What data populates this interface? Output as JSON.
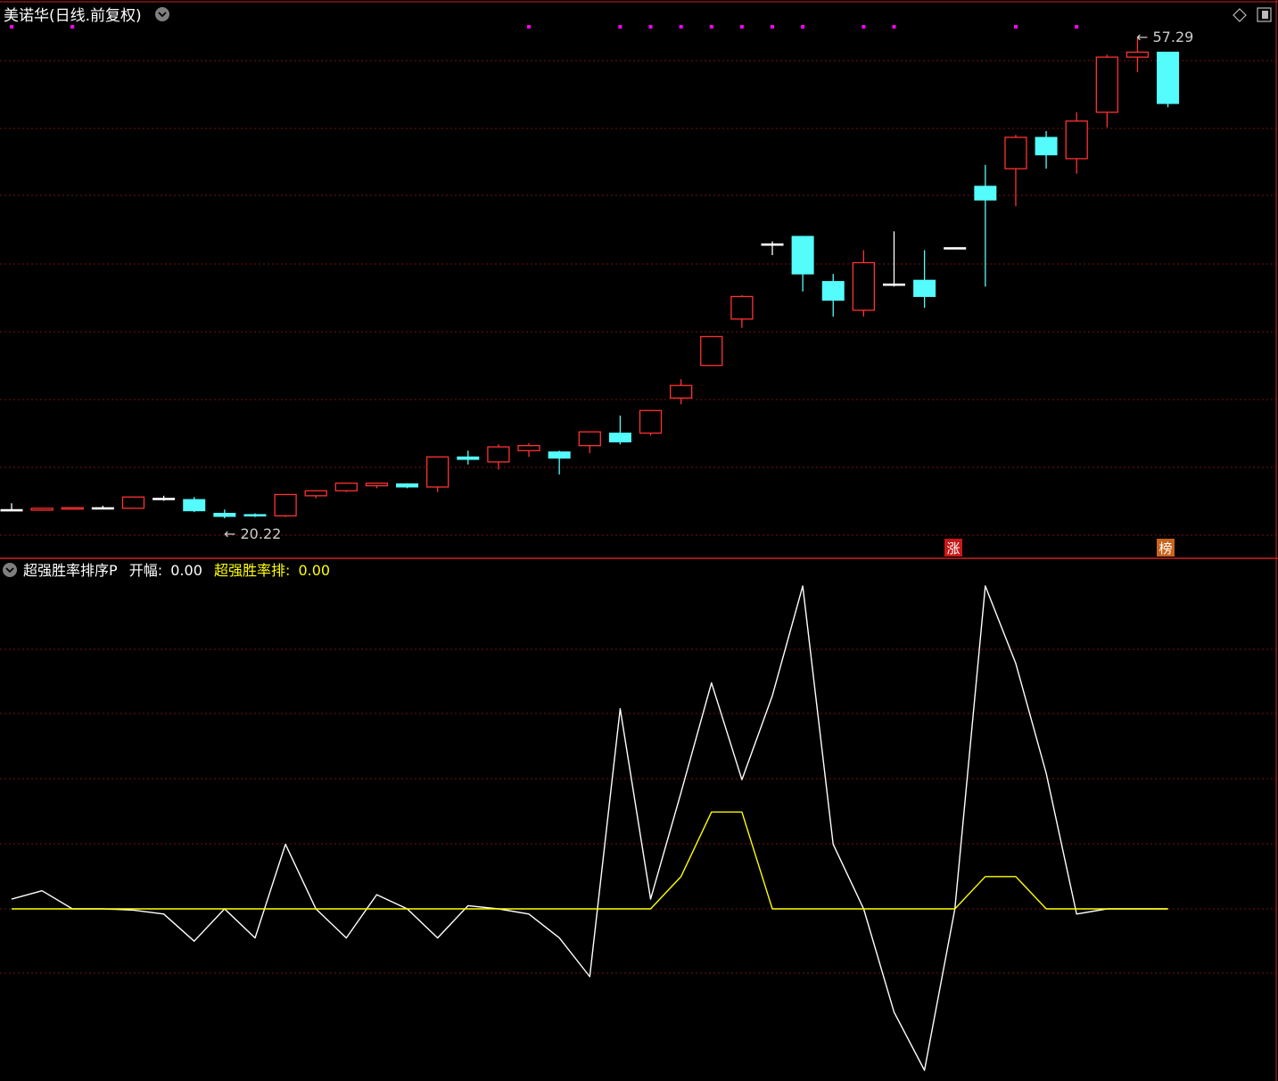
{
  "header": {
    "title": "美诺华(日线.前复权)",
    "dropdown_icon": "chevron-down-icon",
    "right_icons": [
      "diamond-icon",
      "window-icon"
    ]
  },
  "annotations": {
    "low_label": "← 20.22",
    "high_label": "← 57.29",
    "badge_zhang": "涨",
    "badge_bang": "榜"
  },
  "indicator": {
    "name": "超强胜率排序P",
    "field1_label": "开幅:",
    "field1_value": "0.00",
    "field2_label": "超强胜率排:",
    "field2_value": "0.00"
  },
  "colors": {
    "background": "#000000",
    "up": "#ff3232",
    "down": "#54fcfc",
    "doji": "#ffffff",
    "grid": "#7a1010",
    "divider": "#cc2020",
    "marker": "#ff00ff",
    "indicator_white": "#ffffff",
    "indicator_yellow": "#ffff00"
  },
  "chart_data": [
    {
      "type": "candlestick",
      "title": "美诺华(日线.前复权)",
      "ylim": [
        19,
        58.5
      ],
      "grid": true,
      "low_mark": {
        "index": 7,
        "value": 20.22
      },
      "high_mark": {
        "index": 37,
        "value": 57.29
      },
      "marker_indices": [
        0,
        2,
        17,
        20,
        21,
        22,
        23,
        24,
        25,
        26,
        28,
        29,
        33,
        35
      ],
      "badges": [
        {
          "index": 31,
          "text": "涨"
        },
        {
          "index": 38,
          "text": "榜"
        }
      ],
      "candles": [
        {
          "o": 20.9,
          "h": 21.4,
          "l": 20.9,
          "c": 20.9
        },
        {
          "o": 20.85,
          "h": 21.0,
          "l": 20.8,
          "c": 21.0
        },
        {
          "o": 20.95,
          "h": 21.1,
          "l": 20.95,
          "c": 21.05
        },
        {
          "o": 21.05,
          "h": 21.2,
          "l": 20.95,
          "c": 21.05
        },
        {
          "o": 21.0,
          "h": 21.9,
          "l": 21.0,
          "c": 21.9
        },
        {
          "o": 21.8,
          "h": 22.0,
          "l": 21.6,
          "c": 21.8
        },
        {
          "o": 21.7,
          "h": 21.9,
          "l": 20.7,
          "c": 20.8
        },
        {
          "o": 20.6,
          "h": 20.9,
          "l": 20.2,
          "c": 20.35
        },
        {
          "o": 20.5,
          "h": 20.6,
          "l": 20.3,
          "c": 20.4
        },
        {
          "o": 20.4,
          "h": 22.1,
          "l": 20.3,
          "c": 22.1
        },
        {
          "o": 22.0,
          "h": 22.4,
          "l": 21.8,
          "c": 22.4
        },
        {
          "o": 22.4,
          "h": 23.0,
          "l": 22.3,
          "c": 23.0
        },
        {
          "o": 22.8,
          "h": 23.0,
          "l": 22.6,
          "c": 23.0
        },
        {
          "o": 22.95,
          "h": 23.0,
          "l": 22.6,
          "c": 22.7
        },
        {
          "o": 22.7,
          "h": 25.1,
          "l": 22.3,
          "c": 25.1
        },
        {
          "o": 25.1,
          "h": 25.6,
          "l": 24.5,
          "c": 24.9
        },
        {
          "o": 24.7,
          "h": 26.1,
          "l": 24.1,
          "c": 25.9
        },
        {
          "o": 25.6,
          "h": 26.2,
          "l": 25.1,
          "c": 26.0
        },
        {
          "o": 25.5,
          "h": 25.6,
          "l": 23.7,
          "c": 25.0
        },
        {
          "o": 26.0,
          "h": 27.1,
          "l": 25.4,
          "c": 27.1
        },
        {
          "o": 27.0,
          "h": 28.4,
          "l": 26.1,
          "c": 26.3
        },
        {
          "o": 27.0,
          "h": 28.8,
          "l": 26.8,
          "c": 28.8
        },
        {
          "o": 29.8,
          "h": 31.3,
          "l": 29.3,
          "c": 30.8
        },
        {
          "o": 32.4,
          "h": 34.7,
          "l": 32.4,
          "c": 34.7
        },
        {
          "o": 36.1,
          "h": 38.0,
          "l": 35.4,
          "c": 37.9
        },
        {
          "o": 42.1,
          "h": 42.3,
          "l": 41.2,
          "c": 42.1
        },
        {
          "o": 42.7,
          "h": 42.7,
          "l": 38.3,
          "c": 39.7
        },
        {
          "o": 39.1,
          "h": 39.7,
          "l": 36.3,
          "c": 37.6
        },
        {
          "o": 36.8,
          "h": 41.6,
          "l": 36.3,
          "c": 40.6
        },
        {
          "o": 38.9,
          "h": 43.1,
          "l": 38.7,
          "c": 38.9
        },
        {
          "o": 39.2,
          "h": 41.6,
          "l": 37.0,
          "c": 37.9
        },
        {
          "o": 41.8,
          "h": 41.8,
          "l": 41.8,
          "c": 41.8
        },
        {
          "o": 46.7,
          "h": 48.4,
          "l": 38.7,
          "c": 45.6
        },
        {
          "o": 48.1,
          "h": 50.8,
          "l": 45.1,
          "c": 50.6
        },
        {
          "o": 50.6,
          "h": 51.1,
          "l": 48.1,
          "c": 49.2
        },
        {
          "o": 48.9,
          "h": 52.6,
          "l": 47.7,
          "c": 51.9
        },
        {
          "o": 52.6,
          "h": 57.2,
          "l": 51.4,
          "c": 57.0
        },
        {
          "o": 57.0,
          "h": 58.5,
          "l": 55.8,
          "c": 57.4
        },
        {
          "o": 57.4,
          "h": 57.4,
          "l": 53.0,
          "c": 53.3
        }
      ]
    },
    {
      "type": "line",
      "title": "超强胜率排序P",
      "ylim": [
        -2.5,
        4.8
      ],
      "grid": true,
      "series": [
        {
          "name": "开幅",
          "color": "#ffffff",
          "values": [
            0.15,
            0.28,
            0,
            0,
            -0.02,
            -0.08,
            -0.5,
            0,
            -0.45,
            1.0,
            0,
            -0.45,
            0.22,
            0,
            -0.45,
            0.05,
            0,
            -0.08,
            -0.45,
            -1.05,
            3.1,
            0.15,
            1.8,
            3.5,
            2.0,
            3.3,
            5.0,
            1.0,
            0,
            -1.6,
            -2.5,
            0,
            5.0,
            3.8,
            2.1,
            -0.08,
            0,
            0,
            0
          ]
        },
        {
          "name": "超强胜率排",
          "color": "#ffff00",
          "values": [
            0,
            0,
            0,
            0,
            0,
            0,
            0,
            0,
            0,
            0,
            0,
            0,
            0,
            0,
            0,
            0,
            0,
            0,
            0,
            0,
            0,
            0,
            0.5,
            1.5,
            1.5,
            0,
            0,
            0,
            0,
            0,
            0,
            0,
            0.5,
            0.5,
            0,
            0,
            0,
            0,
            0
          ]
        }
      ]
    }
  ]
}
